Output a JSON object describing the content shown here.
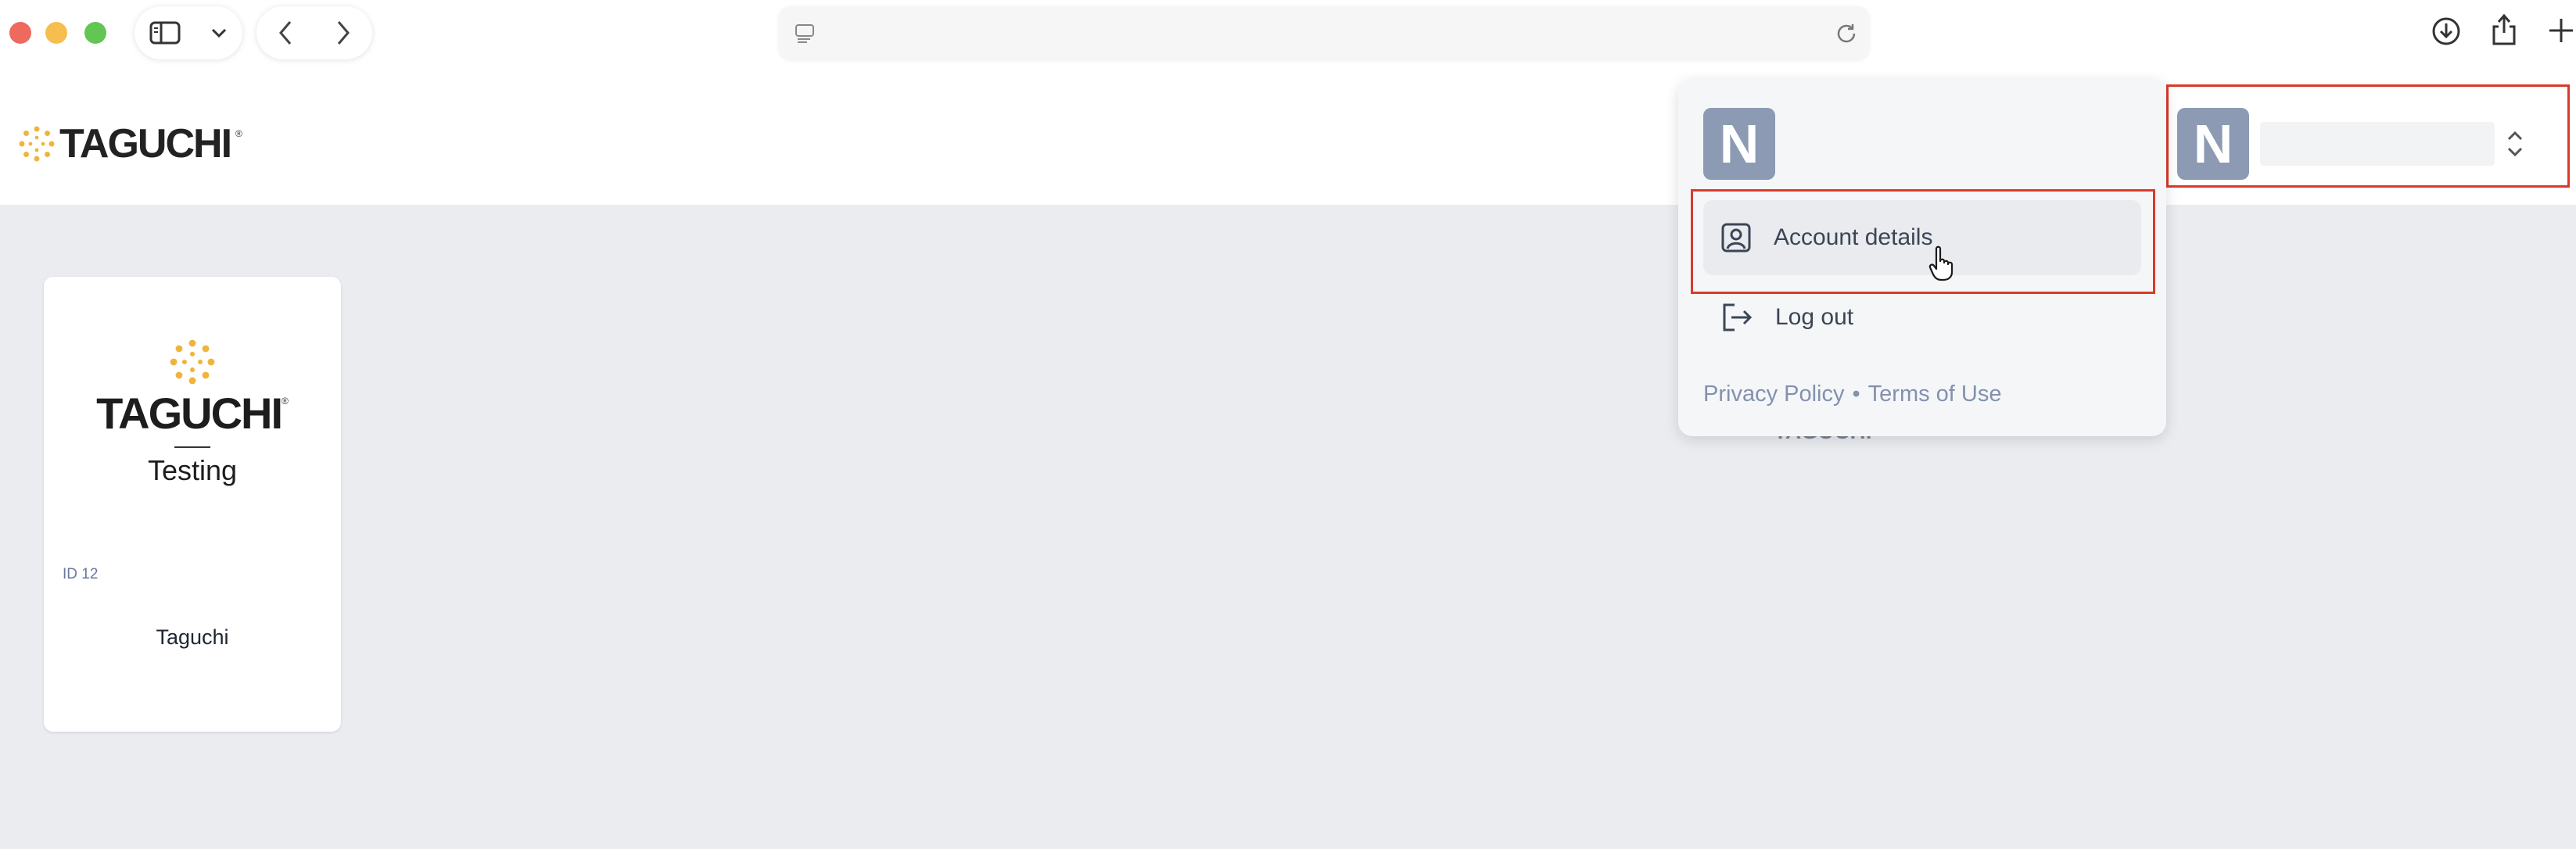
{
  "brand": {
    "logo_text": "TAGUCHI",
    "registered_mark": "®"
  },
  "account": {
    "avatar_initial": "N",
    "name_value": ""
  },
  "dropdown": {
    "avatar_initial": "N",
    "items": [
      {
        "label": "Account details",
        "icon": "user-square-icon"
      },
      {
        "label": "Log out",
        "icon": "logout-icon"
      }
    ],
    "footer": {
      "privacy_label": "Privacy Policy",
      "separator": "•",
      "terms_label": "Terms of Use"
    }
  },
  "organization_card": {
    "logo_text": "TAGUCHI",
    "registered_mark": "®",
    "subtitle": "Testing",
    "id_label": "ID 12",
    "name": "Taguchi"
  },
  "background_fragment": "TAGUCHI",
  "colors": {
    "avatar": "#8c9ab3",
    "highlight": "#d93a2b",
    "brand_gold": "#f0b43c",
    "page_bg": "#eaecf0"
  }
}
